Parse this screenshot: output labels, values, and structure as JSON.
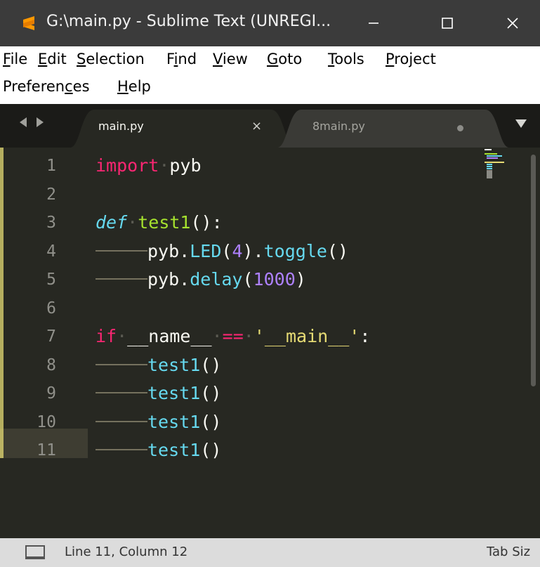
{
  "window": {
    "title": "G:\\main.py - Sublime Text (UNREGI...",
    "app_icon": "sublime-text-icon",
    "controls": [
      "minimize-icon",
      "maximize-icon",
      "close-icon"
    ]
  },
  "menu": {
    "items": [
      {
        "label": "File",
        "mnemonic_index": 0
      },
      {
        "label": "Edit",
        "mnemonic_index": 0
      },
      {
        "label": "Selection",
        "mnemonic_index": 0
      },
      {
        "label": "Find",
        "mnemonic_index": 1
      },
      {
        "label": "View",
        "mnemonic_index": 0
      },
      {
        "label": "Goto",
        "mnemonic_index": 0
      },
      {
        "label": "Tools",
        "mnemonic_index": 0
      },
      {
        "label": "Project",
        "mnemonic_index": 0
      },
      {
        "label": "Preferences",
        "mnemonic_index": 8
      },
      {
        "label": "Help",
        "mnemonic_index": 0
      }
    ]
  },
  "tabs": {
    "items": [
      {
        "label": "main.py",
        "active": true,
        "close_glyph": "×"
      },
      {
        "label": "8main.py",
        "active": false,
        "modified": true
      }
    ]
  },
  "editor": {
    "line_numbers": [
      "1",
      "2",
      "3",
      "4",
      "5",
      "6",
      "7",
      "8",
      "9",
      "10",
      "11"
    ],
    "current_line": 11,
    "lines": [
      [
        {
          "t": "import",
          "c": "kw"
        },
        {
          "t": "·",
          "c": "ws"
        },
        {
          "t": "pyb",
          "c": "plain"
        }
      ],
      [],
      [
        {
          "t": "def",
          "c": "def"
        },
        {
          "t": "·",
          "c": "ws"
        },
        {
          "t": "test1",
          "c": "fn"
        },
        {
          "t": "():",
          "c": "plain"
        }
      ],
      [
        {
          "t": "",
          "c": "indent"
        },
        {
          "t": "pyb.",
          "c": "plain"
        },
        {
          "t": "LED",
          "c": "call"
        },
        {
          "t": "(",
          "c": "plain"
        },
        {
          "t": "4",
          "c": "num"
        },
        {
          "t": ").",
          "c": "plain"
        },
        {
          "t": "toggle",
          "c": "call"
        },
        {
          "t": "()",
          "c": "plain"
        }
      ],
      [
        {
          "t": "",
          "c": "indent"
        },
        {
          "t": "pyb.",
          "c": "plain"
        },
        {
          "t": "delay",
          "c": "call"
        },
        {
          "t": "(",
          "c": "plain"
        },
        {
          "t": "1000",
          "c": "num"
        },
        {
          "t": ")",
          "c": "plain"
        }
      ],
      [],
      [
        {
          "t": "if",
          "c": "kw"
        },
        {
          "t": "·",
          "c": "ws"
        },
        {
          "t": "__name__",
          "c": "plain"
        },
        {
          "t": "·",
          "c": "ws"
        },
        {
          "t": "==",
          "c": "kw"
        },
        {
          "t": "·",
          "c": "ws"
        },
        {
          "t": "'__main__'",
          "c": "str"
        },
        {
          "t": ":",
          "c": "plain"
        }
      ],
      [
        {
          "t": "",
          "c": "indent"
        },
        {
          "t": "test1",
          "c": "call"
        },
        {
          "t": "()",
          "c": "plain"
        }
      ],
      [
        {
          "t": "",
          "c": "indent"
        },
        {
          "t": "test1",
          "c": "call"
        },
        {
          "t": "()",
          "c": "plain"
        }
      ],
      [
        {
          "t": "",
          "c": "indent"
        },
        {
          "t": "test1",
          "c": "call"
        },
        {
          "t": "()",
          "c": "plain"
        }
      ],
      [
        {
          "t": "",
          "c": "indent"
        },
        {
          "t": "test1",
          "c": "call"
        },
        {
          "t": "()",
          "c": "plain"
        }
      ]
    ]
  },
  "status": {
    "position": "Line 11, Column 12",
    "tab_size": "Tab Siz"
  },
  "colors": {
    "background": "#272822",
    "keyword": "#f92672",
    "function": "#a6e22e",
    "builtin": "#66d9ef",
    "number": "#ae81ff",
    "string": "#e6db74",
    "line_number": "#90908a"
  }
}
